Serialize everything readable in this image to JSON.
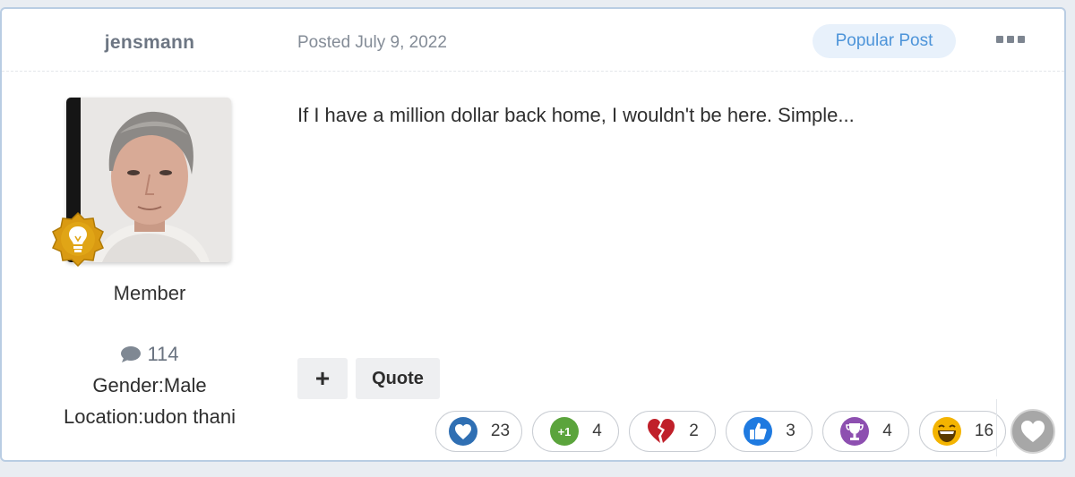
{
  "post": {
    "author": "jensmann",
    "date": "Posted July 9, 2022",
    "badge": "Popular Post",
    "content": "If I have a million dollar back home, I wouldn't be here. Simple..."
  },
  "author_info": {
    "rank": "Member",
    "posts_count": "114",
    "gender": "Gender:Male",
    "location": "Location:udon thani"
  },
  "actions": {
    "plus_label": "+",
    "quote_label": "Quote"
  },
  "reactions": [
    {
      "icon": "heart-icon",
      "count": "23",
      "color": "#2f6fb3"
    },
    {
      "icon": "plus-one-icon",
      "count": "4",
      "color": "#5ba43c"
    },
    {
      "icon": "broken-heart-icon",
      "count": "2",
      "color": "#c0202a"
    },
    {
      "icon": "thumbs-up-icon",
      "count": "3",
      "color": "#1f7ae0"
    },
    {
      "icon": "trophy-icon",
      "count": "4",
      "color": "#8d4fb0"
    },
    {
      "icon": "laughing-face-icon",
      "count": "16",
      "color": "#f4b400"
    }
  ],
  "colors": {
    "accent": "#4d94d9",
    "border": "#b9cde3",
    "rank_badge": "#d99a12"
  }
}
